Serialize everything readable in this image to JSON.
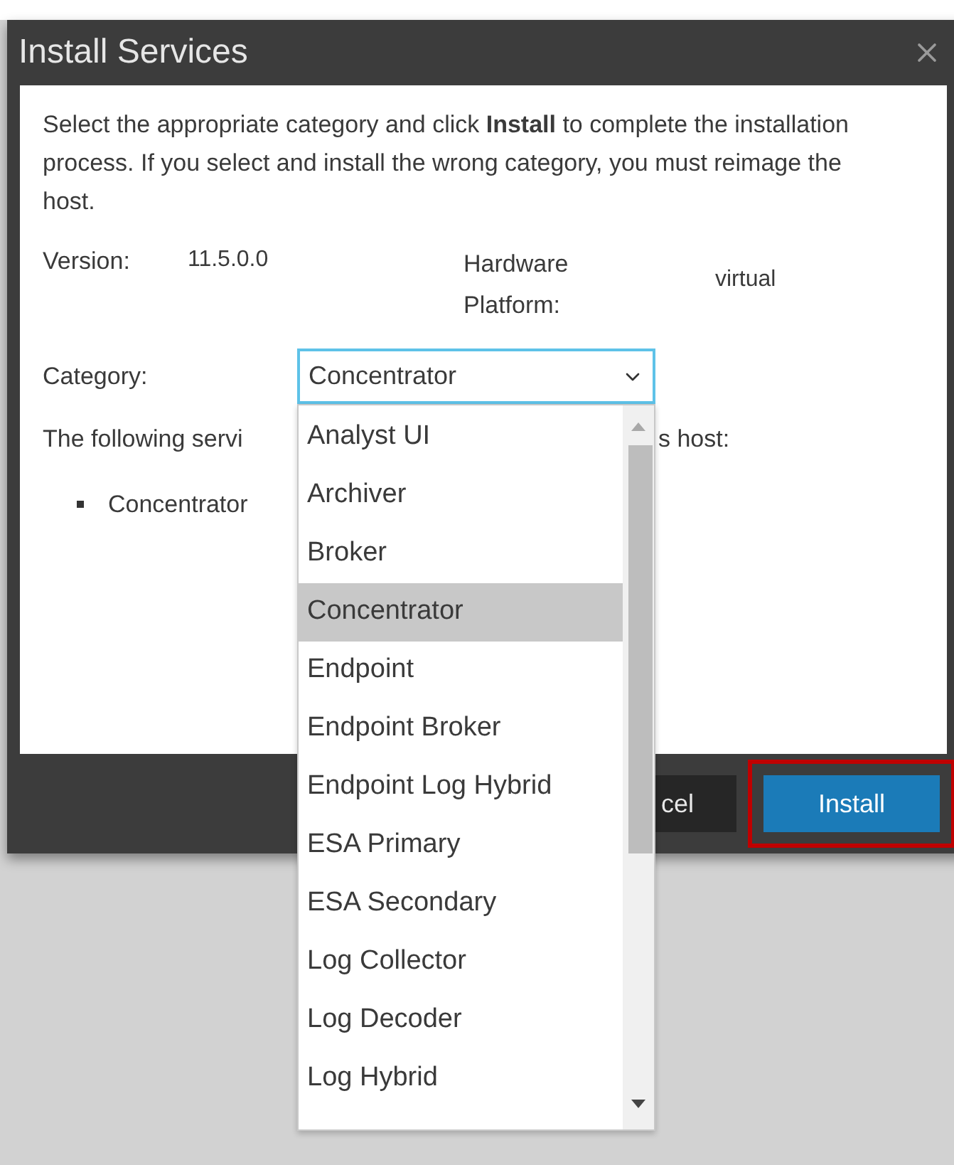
{
  "dialog": {
    "title": "Install Services",
    "description": "Select the appropriate category and click **Install** to complete the installation process. If you select and install the wrong category, you must reimage the host.",
    "version_label": "Version:",
    "version": "11.5.0.0",
    "platform_label": "Hardware Platform:",
    "platform": "virtual",
    "category_label": "Category:",
    "category": {
      "value": "Concentrator",
      "expanded": true,
      "options": [
        {
          "label": "Analyst UI",
          "selected": false
        },
        {
          "label": "Archiver",
          "selected": false
        },
        {
          "label": "Broker",
          "selected": false
        },
        {
          "label": "Concentrator",
          "selected": true
        },
        {
          "label": "Endpoint",
          "selected": false
        },
        {
          "label": "Endpoint Broker",
          "selected": false
        },
        {
          "label": "Endpoint Log Hybrid",
          "selected": false
        },
        {
          "label": "ESA Primary",
          "selected": false
        },
        {
          "label": "ESA Secondary",
          "selected": false
        },
        {
          "label": "Log Collector",
          "selected": false
        },
        {
          "label": "Log Decoder",
          "selected": false
        },
        {
          "label": "Log Hybrid",
          "selected": false
        }
      ]
    },
    "services_text_start": "The following servi",
    "services_text_end": "s host:",
    "services": [
      "Concentrator"
    ],
    "buttons": [
      {
        "label": "cel",
        "kind": "secondary",
        "highlighted": false
      },
      {
        "label": "Install",
        "kind": "primary",
        "highlighted": true
      }
    ]
  }
}
